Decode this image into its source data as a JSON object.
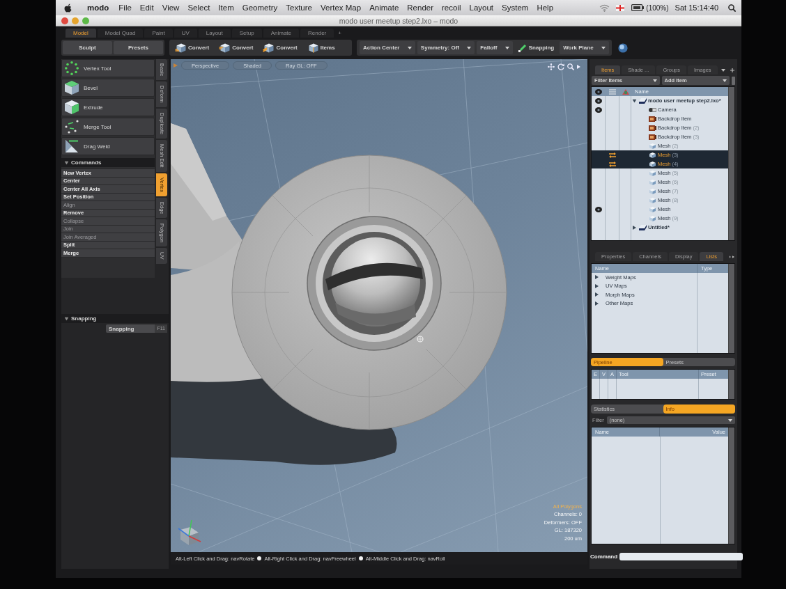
{
  "menubar": {
    "app": "modo",
    "items": [
      "File",
      "Edit",
      "View",
      "Select",
      "Item",
      "Geometry",
      "Texture",
      "Vertex Map",
      "Animate",
      "Render",
      "recoil",
      "Layout",
      "System",
      "Help"
    ],
    "battery": "(100%)",
    "clock": "Sat 15:14:40"
  },
  "window": {
    "title": "modo user meetup step2.lxo – modo"
  },
  "layout_tabs": [
    {
      "label": "Model",
      "selected": true
    },
    {
      "label": "Model Quad",
      "selected": false
    },
    {
      "label": "Paint",
      "selected": false
    },
    {
      "label": "UV",
      "selected": false
    },
    {
      "label": "Layout",
      "selected": false
    },
    {
      "label": "Setup",
      "selected": false
    },
    {
      "label": "Animate",
      "selected": false
    },
    {
      "label": "Render",
      "selected": false
    }
  ],
  "add_tab": "+",
  "toolbar": {
    "modes": [
      "Sculpt",
      "Presets"
    ],
    "convert": [
      {
        "label": "Convert",
        "kind": "vertices"
      },
      {
        "label": "Convert",
        "kind": "edges"
      },
      {
        "label": "Convert",
        "kind": "polygons"
      },
      {
        "label": "Items",
        "kind": "items"
      }
    ],
    "dropdowns": [
      "Action Center",
      "Symmetry: Off",
      "Falloff"
    ],
    "snapping": "Snapping",
    "work_plane": "Work Plane"
  },
  "left_panel": {
    "tools": [
      {
        "label": "Vertex Tool",
        "kind": "vertex"
      },
      {
        "label": "Bevel",
        "kind": "bevel"
      },
      {
        "label": "Extrude",
        "kind": "extrude"
      },
      {
        "label": "Merge Tool",
        "kind": "merge"
      },
      {
        "label": "Drag Weld",
        "kind": "weld"
      }
    ],
    "side_tabs": [
      {
        "label": "Basic",
        "selected": false
      },
      {
        "label": "Deform",
        "selected": false
      },
      {
        "label": "Duplicate",
        "selected": false
      },
      {
        "label": "Mesh Edit",
        "selected": false
      },
      {
        "label": "Vertex",
        "selected": true
      },
      {
        "label": "Edge",
        "selected": false
      },
      {
        "label": "Polygon",
        "selected": false
      },
      {
        "label": "UV",
        "selected": false
      }
    ],
    "commands_section": {
      "title": "Commands",
      "expanded": true
    },
    "commands": [
      {
        "label": "New Vertex",
        "disabled": false
      },
      {
        "label": "Center",
        "disabled": false
      },
      {
        "label": "Center All Axis",
        "disabled": false
      },
      {
        "label": "Set Position",
        "disabled": false
      },
      {
        "label": "Align",
        "disabled": true
      },
      {
        "label": "Remove",
        "disabled": false
      },
      {
        "label": "Collapse",
        "disabled": true
      },
      {
        "label": "Join",
        "disabled": true
      },
      {
        "label": "Join Averaged",
        "disabled": true
      },
      {
        "label": "Split",
        "disabled": false
      },
      {
        "label": "Merge",
        "disabled": false
      }
    ],
    "snapping_section": {
      "title": "Snapping",
      "expanded": true
    },
    "snapping_button": {
      "label": "Snapping",
      "shortcut": "F11"
    }
  },
  "viewport": {
    "view_buttons": [
      "Perspective",
      "Shaded",
      "Ray GL: OFF"
    ],
    "info": [
      {
        "text": "All Polygons",
        "kind": "highlight"
      },
      {
        "text": "Channels: 0",
        "kind": "plain"
      },
      {
        "text": "Deformers: OFF",
        "kind": "plain"
      },
      {
        "text": "GL: 187320",
        "kind": "plain"
      },
      {
        "text": "200 um",
        "kind": "plain"
      }
    ]
  },
  "status_hints": [
    "Alt-Left Click and Drag: navRotate",
    "Alt-Right Click and Drag: navFreewheel",
    "Alt-Middle Click and Drag: navRoll"
  ],
  "items_panel": {
    "tabs": [
      {
        "label": "Items",
        "selected": true
      },
      {
        "label": "Shade ...",
        "selected": false
      },
      {
        "label": "Groups",
        "selected": false
      },
      {
        "label": "Images",
        "selected": false
      }
    ],
    "filter": "Filter Items",
    "add_item": "Add Item",
    "name_column": "Name",
    "tree": [
      {
        "name": "modo user meetup step2.lxo*",
        "kind": "scene",
        "visible": true,
        "selected": false,
        "expanded": true,
        "children": [
          {
            "name": "Camera",
            "kind": "camera",
            "visible": true,
            "selected": false
          },
          {
            "name": "Backdrop Item",
            "kind": "backdrop",
            "visible": false,
            "selected": false
          },
          {
            "name": "Backdrop Item",
            "suffix": "(2)",
            "kind": "backdrop",
            "visible": false,
            "selected": false
          },
          {
            "name": "Backdrop Item",
            "suffix": "(3)",
            "kind": "backdrop",
            "visible": false,
            "selected": false
          },
          {
            "name": "Mesh",
            "suffix": "(2)",
            "kind": "mesh",
            "visible": false,
            "selected": false
          },
          {
            "name": "Mesh",
            "suffix": "(3)",
            "kind": "mesh",
            "visible": false,
            "selected": true
          },
          {
            "name": "Mesh",
            "suffix": "(4)",
            "kind": "mesh",
            "visible": false,
            "selected": true
          },
          {
            "name": "Mesh",
            "suffix": "(5)",
            "kind": "mesh",
            "visible": false,
            "selected": false
          },
          {
            "name": "Mesh",
            "suffix": "(6)",
            "kind": "mesh",
            "visible": false,
            "selected": false
          },
          {
            "name": "Mesh",
            "suffix": "(7)",
            "kind": "mesh",
            "visible": false,
            "selected": false
          },
          {
            "name": "Mesh",
            "suffix": "(8)",
            "kind": "mesh",
            "visible": false,
            "selected": false
          },
          {
            "name": "Mesh",
            "kind": "mesh",
            "visible": true,
            "selected": false
          },
          {
            "name": "Mesh",
            "suffix": "(9)",
            "kind": "mesh",
            "visible": false,
            "selected": false
          }
        ]
      },
      {
        "name": "Untitled*",
        "kind": "scene",
        "visible": false,
        "selected": false,
        "expanded": false
      }
    ]
  },
  "lists_panel": {
    "tabs": [
      {
        "label": "Properties",
        "selected": false
      },
      {
        "label": "Channels",
        "selected": false
      },
      {
        "label": "Display",
        "selected": false
      },
      {
        "label": "Lists",
        "selected": true
      }
    ],
    "columns": [
      "Name",
      "Type"
    ],
    "rows": [
      {
        "label": "Weight Maps",
        "expanded": false
      },
      {
        "label": "UV Maps",
        "expanded": false
      },
      {
        "label": "Morph Maps",
        "expanded": false
      },
      {
        "label": "Other Maps",
        "expanded": false
      }
    ]
  },
  "pipeline_panel": {
    "tabs": [
      {
        "label": "Pipeline",
        "selected": true
      },
      {
        "label": "Presets",
        "selected": false
      }
    ],
    "columns": [
      "E",
      "V",
      "A",
      "Tool",
      "Preset"
    ]
  },
  "info_panel": {
    "tabs": [
      {
        "label": "Statistics",
        "selected": false
      },
      {
        "label": "Info",
        "selected": true
      }
    ],
    "filter_label": "Filter",
    "filter_value": "(none)",
    "columns": [
      "Name",
      "Value"
    ]
  },
  "command_bar": {
    "label": "Command"
  }
}
